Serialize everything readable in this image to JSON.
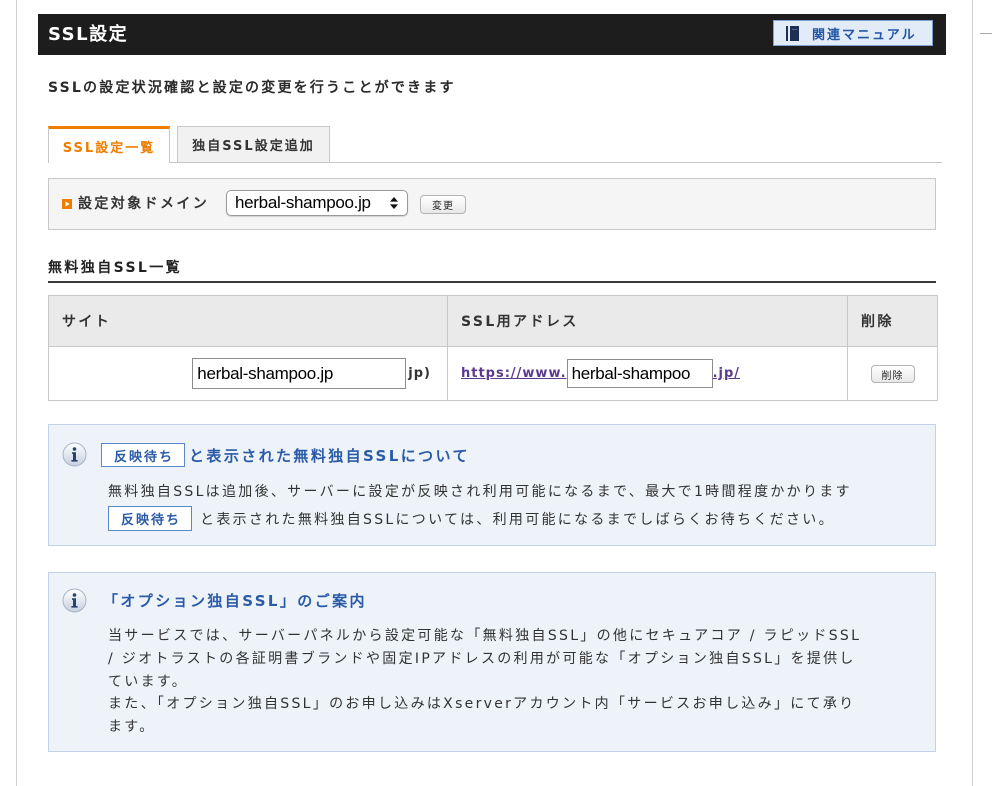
{
  "header": {
    "title": "SSL設定",
    "manual_label": "関連マニュアル"
  },
  "description": "SSLの設定状況確認と設定の変更を行うことができます",
  "tabs": [
    {
      "label": "SSL設定一覧",
      "active": true
    },
    {
      "label": "独自SSL設定追加",
      "active": false
    }
  ],
  "domain_selector": {
    "label": "設定対象ドメイン",
    "selected": "herbal-shampoo.jp",
    "change_label": "変更"
  },
  "ssl_list": {
    "heading": "無料独自SSL一覧",
    "columns": [
      "サイト",
      "SSL用アドレス",
      "削除"
    ],
    "rows": [
      {
        "site_domain": "herbal-shampoo.jp",
        "site_suffix": "jp)",
        "url_prefix": "https://www.",
        "url_domain": "herbal-shampoo",
        "url_suffix": ".jp/",
        "delete_label": "削除"
      }
    ]
  },
  "notice_pending": {
    "badge": "反映待ち",
    "heading": "と表示された無料独自SSLについて",
    "line1": "無料独自SSLは追加後、サーバーに設定が反映され利用可能になるまで、最大で1時間程度かかります",
    "line2_badge": "反映待ち",
    "line2": "と表示された無料独自SSLについては、利用可能になるまでしばらくお待ちください。"
  },
  "notice_option": {
    "heading": "「オプション独自SSL」のご案内",
    "lines": [
      "当サービスでは、サーバーパネルから設定可能な「無料独自SSL」の他にセキュアコア / ラピッドSSL",
      "/ ジオトラストの各証明書ブランドや固定IPアドレスの利用が可能な「オプション独自SSL」を提供し",
      "ています。",
      "また、「オプション独自SSL」のお申し込みはXserverアカウント内「サービスお申し込み」にて承り",
      "ます。"
    ]
  },
  "icons": {
    "manual_button": "book-icon",
    "domain_label": "orange-play-icon",
    "select": "select-arrows-icon",
    "notices": "info-icon"
  },
  "colors": {
    "header_bg": "#1d1d1d",
    "accent": "#ef7d00",
    "link": "#5b3a8f",
    "info_text": "#2b5ba7",
    "info_bg": "#eef3fa",
    "info_border": "#c3d2e7",
    "table_header_bg": "#eaeaea",
    "panel_bg": "#f5f5f5"
  }
}
